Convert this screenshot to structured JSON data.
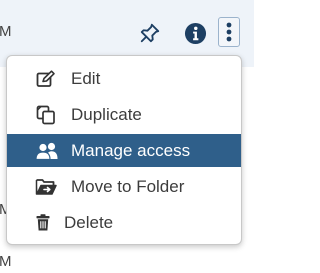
{
  "rows": [
    {
      "cell_text": "M"
    },
    {
      "cell_text": "M"
    },
    {
      "cell_text": "M"
    }
  ],
  "row_actions": {
    "pin_icon": "pin-icon",
    "info_icon": "info-circle-icon",
    "more_icon": "vertical-ellipsis-icon"
  },
  "menu": {
    "items": [
      {
        "label": "Edit",
        "icon": "edit-icon"
      },
      {
        "label": "Duplicate",
        "icon": "duplicate-icon"
      },
      {
        "label": "Manage access",
        "icon": "users-icon"
      },
      {
        "label": "Move to Folder",
        "icon": "folder-move-icon"
      },
      {
        "label": "Delete",
        "icon": "trash-icon"
      }
    ],
    "selected_index": 2
  },
  "colors": {
    "selected_bg": "#2f5f8a",
    "active_row_bg": "#eef3f9",
    "icon_dark": "#1d3f63"
  }
}
